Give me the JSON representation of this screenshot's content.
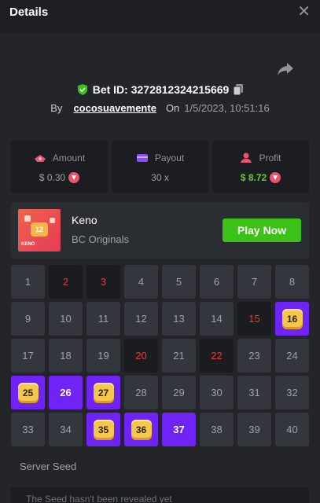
{
  "header": {
    "title": "Details",
    "close_symbol": "✕"
  },
  "bet": {
    "id_label": "Bet ID:",
    "id_value": "3272812324215669",
    "by_label": "By",
    "username": "cocosuavemente",
    "on_label": "On",
    "datetime": "1/5/2023, 10:51:16"
  },
  "stats": {
    "amount": {
      "label": "Amount",
      "value": "$ 0.30"
    },
    "payout": {
      "label": "Payout",
      "value": "30 x"
    },
    "profit": {
      "label": "Profit",
      "value": "$ 8.72"
    }
  },
  "game": {
    "name": "Keno",
    "provider": "BC Originals",
    "play_label": "Play Now",
    "thumb_number": "12",
    "thumb_label": "KENO"
  },
  "grid": {
    "numbers": [
      "1",
      "2",
      "3",
      "4",
      "5",
      "6",
      "7",
      "8",
      "9",
      "10",
      "11",
      "12",
      "13",
      "14",
      "15",
      "16",
      "17",
      "18",
      "19",
      "20",
      "21",
      "22",
      "23",
      "24",
      "25",
      "26",
      "27",
      "28",
      "29",
      "30",
      "31",
      "32",
      "33",
      "34",
      "35",
      "36",
      "37",
      "38",
      "39",
      "40"
    ],
    "drawn_only": [
      2,
      3,
      15,
      20,
      22
    ],
    "selected_only": [
      26,
      37
    ],
    "hits": [
      16,
      25,
      27,
      35,
      36
    ]
  },
  "seed": {
    "label": "Server Seed",
    "text": "The Seed hasn't been revealed yet"
  },
  "colors": {
    "accent_green": "#3bc117",
    "profit_green": "#5fd31f",
    "selected_purple": "#6f23f4",
    "drawn_red": "#e23b3b",
    "gem_yellow": "#f6c84a"
  },
  "icons": {
    "close": "close-icon",
    "share": "share-icon",
    "verified": "shield-check-icon",
    "copy": "copy-icon",
    "amount": "money-icon",
    "payout": "wallet-icon",
    "profit": "user-profit-icon",
    "currency": "tron-coin-icon"
  }
}
